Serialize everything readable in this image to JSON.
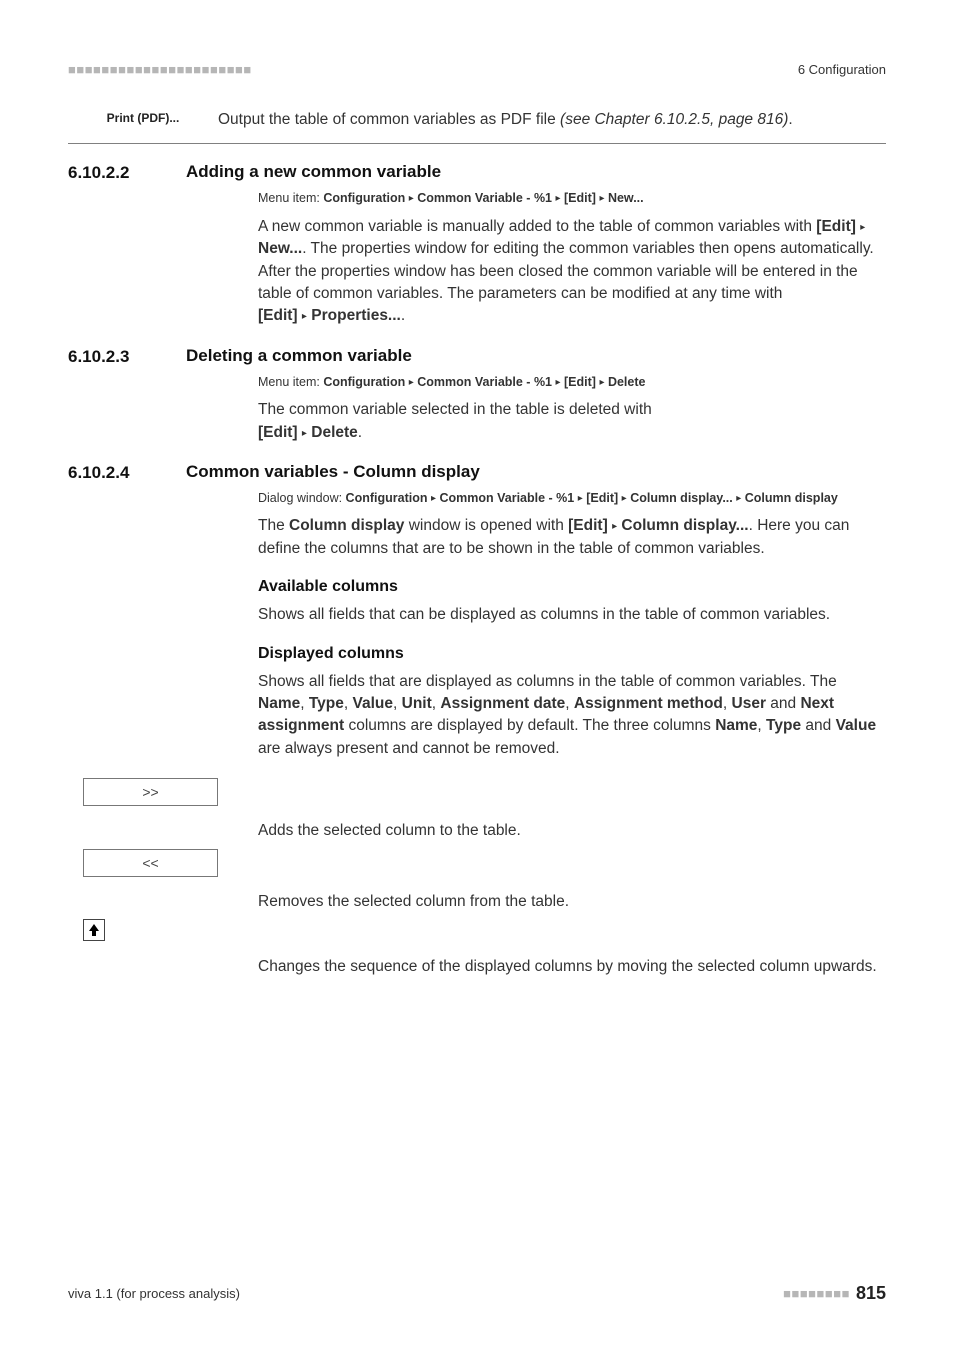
{
  "header": {
    "dashes": "■■■■■■■■■■■■■■■■■■■■■■",
    "chapter": "6 Configuration"
  },
  "item_row": {
    "label": "Print (PDF)...",
    "text_before": "Output the table of common variables as PDF file ",
    "text_ref": "(see Chapter 6.10.2.5, page 816)",
    "text_after": "."
  },
  "s1": {
    "num": "6.10.2.2",
    "title": "Adding a new common variable",
    "menu_prefix": "Menu item: ",
    "m1": "Configuration",
    "m2": "Common Variable - %1",
    "m3": "[Edit]",
    "m4": "New...",
    "p1a": "A new common variable is manually added to the table of common variables with ",
    "p1b": "[Edit]",
    "p1c": "New...",
    "p1d": ". The properties window for editing the common variables then opens automatically. After the properties window has been closed the common variable will be entered in the table of common variables. The parameters can be modified at any time with",
    "p2a": "[Edit]",
    "p2b": "Properties...",
    "p2c": "."
  },
  "s2": {
    "num": "6.10.2.3",
    "title": "Deleting a common variable",
    "menu_prefix": "Menu item: ",
    "m1": "Configuration",
    "m2": "Common Variable - %1",
    "m3": "[Edit]",
    "m4": "Delete",
    "p1a": "The common variable selected in the table is deleted with",
    "p2a": "[Edit]",
    "p2b": "Delete",
    "p2c": "."
  },
  "s3": {
    "num": "6.10.2.4",
    "title": "Common variables - Column display",
    "menu_prefix": "Dialog window: ",
    "m1": "Configuration",
    "m2": "Common Variable - %1",
    "m3": "[Edit]",
    "m4": "Column display...",
    "m5": "Column display",
    "p1a": "The ",
    "p1b": "Column display",
    "p1c": " window is opened with ",
    "p1d": "[Edit]",
    "p1e": "Column display...",
    "p1f": ". Here you can define the columns that are to be shown in the table of common variables.",
    "h2a": "Available columns",
    "p2": "Shows all fields that can be displayed as columns in the table of common variables.",
    "h2b": "Displayed columns",
    "p3a": "Shows all fields that are displayed as columns in the table of common variables. The ",
    "p3b": "Name",
    "p3c": ", ",
    "p3d": "Type",
    "p3e": ", ",
    "p3f": "Value",
    "p3g": ", ",
    "p3h": "Unit",
    "p3i": ", ",
    "p3j": "Assignment date",
    "p3k": ", ",
    "p3l": "Assignment method",
    "p3m": ", ",
    "p3n": "User",
    "p3o": " and ",
    "p3p": "Next assignment",
    "p3q": " columns are displayed by default. The three columns ",
    "p3r": "Name",
    "p3s": ", ",
    "p3t": "Type",
    "p3u": " and ",
    "p3v": "Value",
    "p3w": " are always present and cannot be removed."
  },
  "buttons": {
    "add": ">>",
    "add_text": "Adds the selected column to the table.",
    "remove": "<<",
    "remove_text": "Removes the selected column from the table.",
    "up_text": "Changes the sequence of the displayed columns by moving the selected column upwards."
  },
  "footer": {
    "left": "viva 1.1 (for process analysis)",
    "dashes": "■■■■■■■■",
    "page": "815"
  },
  "glyphs": {
    "tri": "▸"
  }
}
